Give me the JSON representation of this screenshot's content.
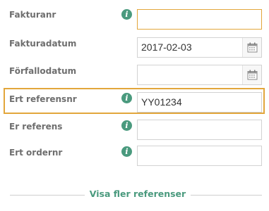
{
  "form": {
    "fields": [
      {
        "label": "Fakturanr",
        "value": "",
        "has_info": true,
        "has_calendar": false,
        "focused": true
      },
      {
        "label": "Fakturadatum",
        "value": "2017-02-03",
        "has_info": false,
        "has_calendar": true,
        "focused": false
      },
      {
        "label": "Förfallodatum",
        "value": "",
        "has_info": false,
        "has_calendar": true,
        "focused": false
      },
      {
        "label": "Ert referensnr",
        "value": "YY01234",
        "has_info": true,
        "has_calendar": false,
        "highlighted": true
      },
      {
        "label": "Er referens",
        "value": "",
        "has_info": true,
        "has_calendar": false,
        "focused": false
      },
      {
        "label": "Ert ordernr",
        "value": "",
        "has_info": true,
        "has_calendar": false,
        "focused": false
      }
    ],
    "info_glyph": "i",
    "more_link": "Visa fler referenser"
  },
  "colors": {
    "accent_green": "#4a9a7e",
    "highlight_orange": "#e2a63b",
    "label_gray": "#6e6e6e",
    "border_gray": "#d2d2d2"
  },
  "icons": {
    "info": "info-circle-icon",
    "calendar": "calendar-icon"
  }
}
